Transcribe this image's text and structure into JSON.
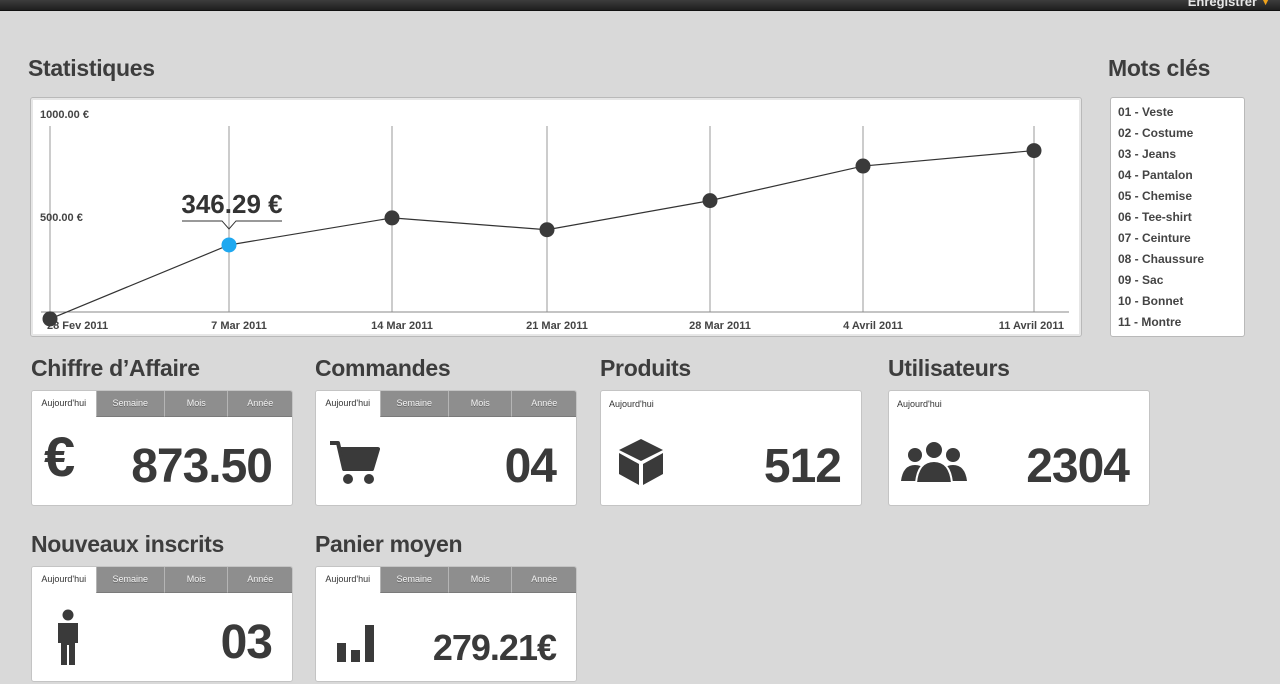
{
  "topbar": {
    "save_label": "Enregistrer"
  },
  "stats": {
    "title": "Statistiques",
    "point_label": "346.29 €"
  },
  "chart_data": {
    "type": "line",
    "categories": [
      "28 Fev 2011",
      "7 Mar 2011",
      "14 Mar 2011",
      "21 Mar 2011",
      "28 Mar 2011",
      "4 Avril 2011",
      "11 Avril 2011"
    ],
    "values": [
      -60,
      346.29,
      495,
      430,
      590,
      780,
      865
    ],
    "y_ticks": [
      "1000.00 €",
      "500.00 €"
    ],
    "ylim": [
      -200,
      1000
    ],
    "highlight_index": 1,
    "colors": {
      "line": "#333333",
      "point": "#3a3a3a",
      "highlight": "#1ea8f0"
    }
  },
  "keywords": {
    "title": "Mots clés",
    "items": [
      "01 - Veste",
      "02 - Costume",
      "03 - Jeans",
      "04 - Pantalon",
      "05 - Chemise",
      "06 - Tee-shirt",
      "07 - Ceinture",
      "08 - Chaussure",
      "09 - Sac",
      "10 - Bonnet",
      "11 - Montre"
    ]
  },
  "tabs": {
    "today": "Aujourd'hui",
    "week": "Semaine",
    "month": "Mois",
    "year": "Année"
  },
  "cards": {
    "revenue": {
      "title": "Chiffre d’Affaire",
      "value": "873.50",
      "icon": "euro-icon"
    },
    "orders": {
      "title": "Commandes",
      "value": "04",
      "icon": "cart-icon"
    },
    "products": {
      "title": "Produits",
      "value": "512",
      "icon": "box-icon"
    },
    "users": {
      "title": "Utilisateurs",
      "value": "2304",
      "icon": "users-icon"
    },
    "signups": {
      "title": "Nouveaux inscrits",
      "value": "03",
      "icon": "person-icon"
    },
    "basket": {
      "title": "Panier moyen",
      "value": "279.21€",
      "icon": "bar-chart-icon"
    }
  }
}
